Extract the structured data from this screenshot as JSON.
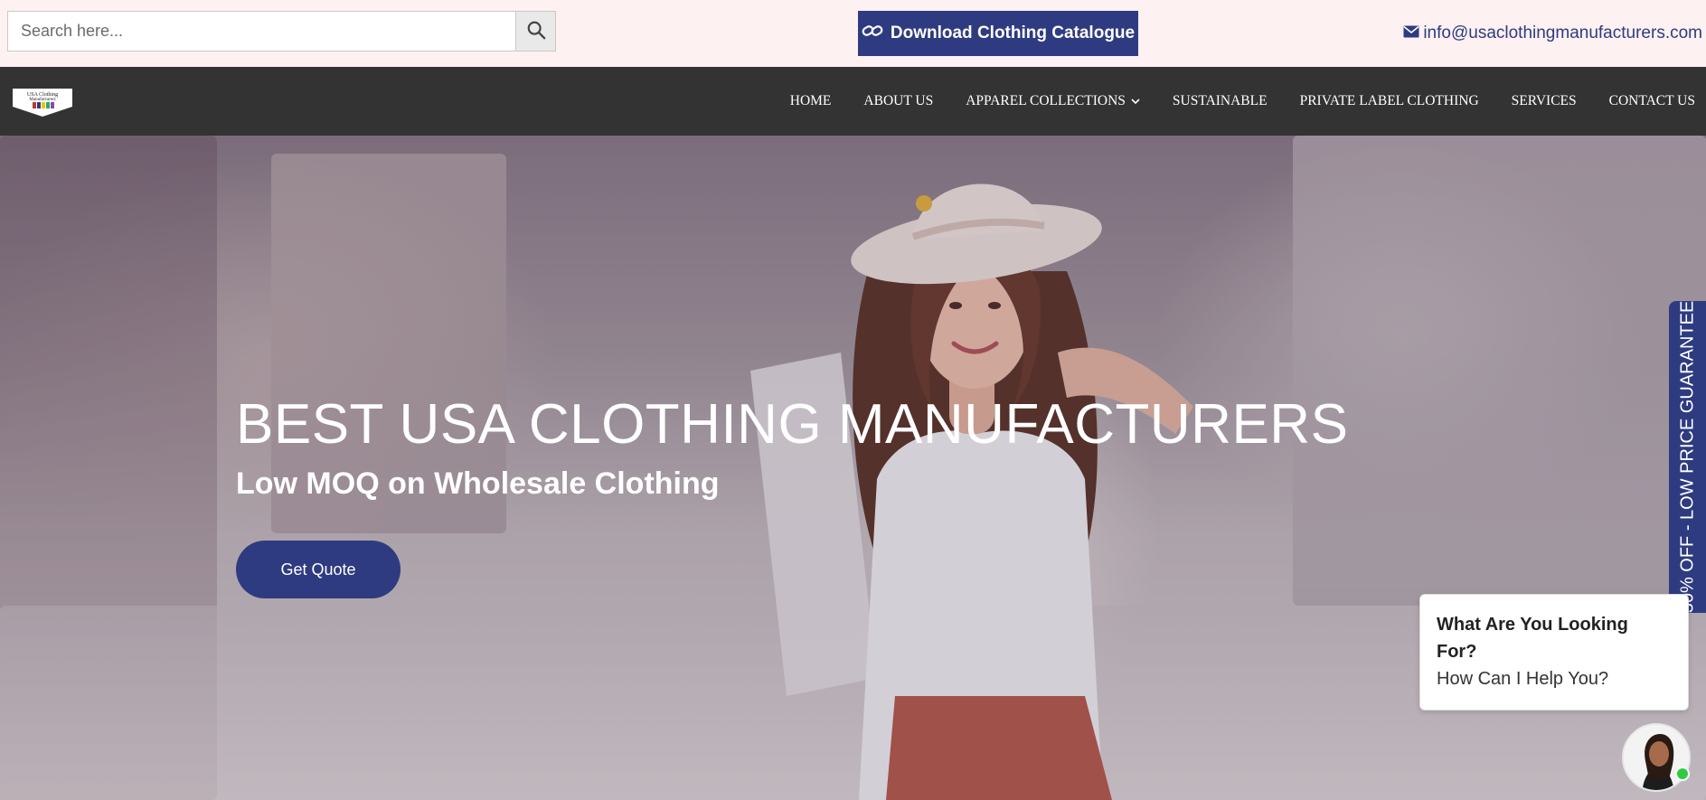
{
  "search": {
    "placeholder": "Search here..."
  },
  "header": {
    "download_label": "Download Clothing Catalogue",
    "email": "info@usaclothingmanufacturers.com"
  },
  "nav": {
    "items": [
      {
        "label": "HOME"
      },
      {
        "label": "ABOUT US"
      },
      {
        "label": "APPAREL COLLECTIONS",
        "has_dropdown": true
      },
      {
        "label": "SUSTAINABLE"
      },
      {
        "label": "PRIVATE LABEL CLOTHING"
      },
      {
        "label": "SERVICES"
      },
      {
        "label": "CONTACT US"
      }
    ]
  },
  "logo": {
    "text": "USA Clothing Manufacturers"
  },
  "hero": {
    "title": "BEST USA CLOTHING MANUFACTURERS",
    "subtitle": "Low MOQ on Wholesale Clothing",
    "cta_label": "Get Quote"
  },
  "side_tab": {
    "text": "30% OFF - LOW PRICE GUARANTEE"
  },
  "chat": {
    "title": "What Are You Looking For?",
    "subtitle": "How Can I Help You?"
  },
  "colors": {
    "brand_blue": "#2e3b80",
    "nav_bg": "#333333",
    "topbar_bg": "#fdf1f1",
    "online_green": "#2ecc40"
  },
  "icons": {
    "search": "search-icon",
    "download": "link-icon",
    "email": "envelope-icon",
    "dropdown": "chevron-down-icon"
  }
}
